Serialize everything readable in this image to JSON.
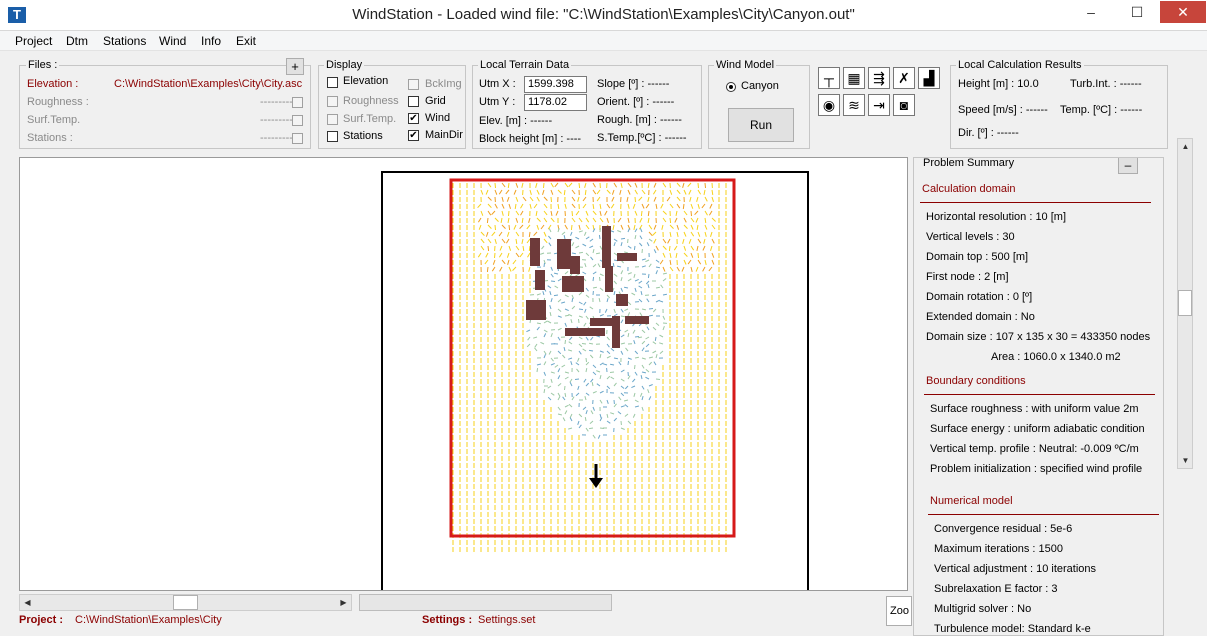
{
  "window": {
    "title": "WindStation - Loaded wind file:  \"C:\\WindStation\\Examples\\City\\Canyon.out\"",
    "minimize": "–",
    "maximize": "☐",
    "close": "✕"
  },
  "menu": [
    "Project",
    "Dtm",
    "Stations",
    "Wind",
    "Info",
    "Exit"
  ],
  "files": {
    "legend": "Files :",
    "add": "+",
    "elevation_label": "Elevation :",
    "elevation_value": "C:\\WindStation\\Examples\\City\\City.asc",
    "roughness_label": "Roughness :",
    "roughness_value": "---------",
    "surftemp_label": "Surf.Temp.",
    "surftemp_value": "---------",
    "stations_label": "Stations :",
    "stations_value": "---------"
  },
  "display": {
    "legend": "Display",
    "elevation": "Elevation",
    "roughness": "Roughness",
    "surftemp": "Surf.Temp.",
    "stations": "Stations",
    "bckimg": "BckImg",
    "grid": "Grid",
    "wind": "Wind",
    "maindir": "MainDir",
    "check": "✔"
  },
  "terrain": {
    "legend": "Local Terrain Data",
    "utmx_label": "Utm X :",
    "utmx_value": "1599.398",
    "utmy_label": "Utm Y :",
    "utmy_value": "1178.02",
    "elev": "Elev. [m] : ------",
    "block": "Block height [m] : ----",
    "slope": "Slope [º] : ------",
    "orient": "Orient. [º] : ------",
    "rough": "Rough. [m] : ------",
    "stemp": "S.Temp.[ºC] : ------"
  },
  "windmodel": {
    "legend": "Wind Model",
    "option": "Canyon",
    "run": "Run"
  },
  "toolbar_icons": [
    "anemometer-icon",
    "grid-icon",
    "vectors-icon",
    "tools-icon",
    "buildings-icon",
    "eye-icon",
    "waves-icon",
    "export-icon",
    "camera-icon"
  ],
  "results": {
    "legend": "Local Calculation Results",
    "height": "Height [m] : 10.0",
    "turb": "Turb.Int. : ------",
    "speed": "Speed [m/s] : ------",
    "temp": "Temp. [ºC] : ------",
    "dir": "Dir. [º] : ------"
  },
  "summary": {
    "legend": "Problem Summary",
    "collapse": "–",
    "calc_head": "Calculation domain",
    "calc": [
      "Horizontal resolution : 10 [m]",
      "Vertical levels : 30",
      "Domain top : 500 [m]",
      "First node : 2 [m]",
      "Domain rotation : 0 [º]",
      "Extended domain : No",
      "Domain size : 107 x 135 x 30 = 433350 nodes",
      "Area : 1060.0 x 1340.0 m2"
    ],
    "bc_head": "Boundary conditions",
    "bc": [
      "Surface roughness : with uniform value 2m",
      "Surface energy : uniform adiabatic condition",
      "Vertical temp. profile : Neutral: -0.009 ºC/m",
      "Problem initialization : specified wind profile"
    ],
    "num_head": "Numerical model",
    "num": [
      "Convergence residual : 5e-6",
      "Maximum iterations : 1500",
      "Vertical adjustment : 10 iterations",
      "Subrelaxation E factor : 3",
      "Multigrid solver : No",
      "Turbulence model: Standard k-e"
    ]
  },
  "statusbar": {
    "project_label": "Project :",
    "project_value": "C:\\WindStation\\Examples\\City",
    "settings_label": "Settings :",
    "settings_value": "Settings.set",
    "zoom": "Zoo"
  },
  "colors": {
    "accent_red": "#8b0000",
    "domain_border": "#d61a1a",
    "wind_yellow": "#f7d21a",
    "building": "#6e3a3a"
  }
}
